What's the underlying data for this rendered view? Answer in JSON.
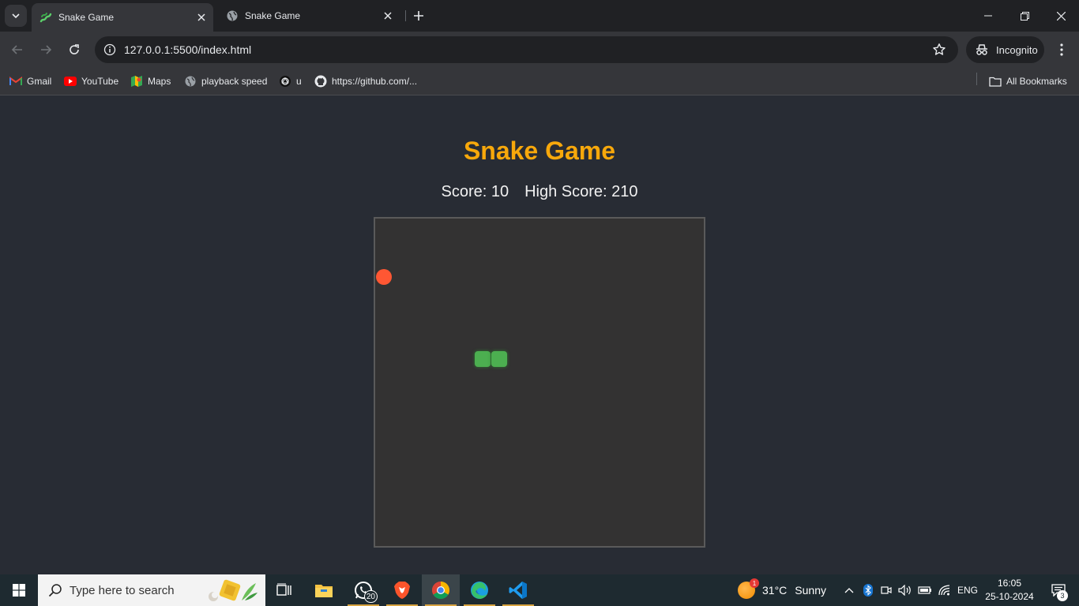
{
  "browser": {
    "tabs": [
      {
        "title": "Snake Game",
        "active": true
      },
      {
        "title": "Snake Game",
        "active": false
      }
    ],
    "url": "127.0.0.1:5500/index.html",
    "profile_label": "Incognito",
    "bookmarks": [
      "Gmail",
      "YouTube",
      "Maps",
      "playback speed",
      "u",
      "https://github.com/..."
    ],
    "all_bookmarks_label": "All Bookmarks"
  },
  "game": {
    "title": "Snake Game",
    "score_label": "Score: 10",
    "high_score_label": "High Score: 210",
    "colors": {
      "title": "#f7a80b",
      "board": "#333232",
      "snake": "#4caf50",
      "food": "#ff5733"
    }
  },
  "taskbar": {
    "search_placeholder": "Type here to search",
    "whatsapp_badge": "20",
    "weather_alert": "1",
    "temperature": "31°C",
    "weather_condition": "Sunny",
    "language": "ENG",
    "time": "16:05",
    "date": "25-10-2024",
    "notification_count": "3"
  }
}
